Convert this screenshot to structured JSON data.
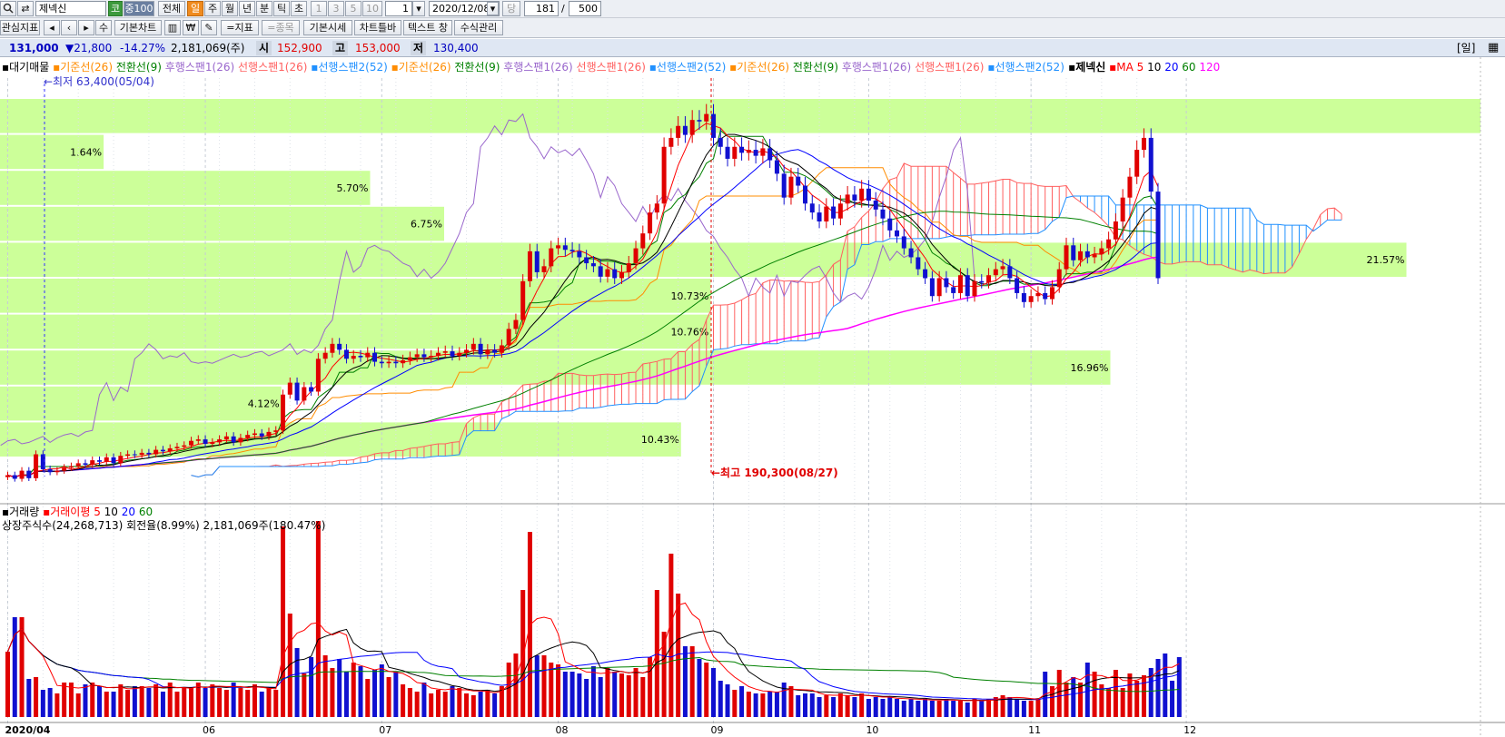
{
  "toolbar": {
    "stock_code": "제넥신",
    "code_badge": "코",
    "index_badge": "중100",
    "period_tabs": [
      "전체",
      "일",
      "주",
      "월",
      "년",
      "분",
      "틱",
      "초"
    ],
    "active_period": "일",
    "intervals": [
      "1",
      "3",
      "5",
      "10"
    ],
    "count_value": "1",
    "date": "2020/12/08",
    "dang": "당",
    "display_count": "181",
    "slash": "/",
    "total_count": "500"
  },
  "toolbar2": {
    "buttons": [
      "관심지표",
      "기본차트",
      "=지표",
      "=종목",
      "기본시세",
      "차트틀바",
      "텍스트 창",
      "수식관리"
    ]
  },
  "infobar": {
    "price": "131,000",
    "change": "▼21,800",
    "change_pct": "-14.27%",
    "volume": "2,181,069(주)",
    "open_label": "시",
    "open": "152,900",
    "high_label": "고",
    "high": "153,000",
    "low_label": "저",
    "low": "130,400",
    "period_badge": "[일]"
  },
  "colors": {
    "up": "#e00000",
    "down": "#1010d0",
    "band": "#ccff99",
    "ma5": "#ff0000",
    "ma10": "#000000",
    "ma20": "#0000ff",
    "ma60": "#008000",
    "ma120": "#ff00ff",
    "lead_span1": "#ff6060",
    "lead_span2": "#2090ff",
    "base_line": "#ff8c00",
    "conv_line": "#008000",
    "lag_span": "#9966cc"
  },
  "legend": [
    {
      "text": "▪대기매물",
      "color": "#000"
    },
    {
      "text": "▪기준선(26)",
      "color": "#ff8c00"
    },
    {
      "text": "전환선(9)",
      "color": "#008000"
    },
    {
      "text": "후행스팬1(26)",
      "color": "#9966cc"
    },
    {
      "text": "선행스팬1(26)",
      "color": "#ff6060"
    },
    {
      "text": "▪선행스팬2(52)",
      "color": "#2090ff"
    },
    {
      "text": "▪기준선(26)",
      "color": "#ff8c00"
    },
    {
      "text": "전환선(9)",
      "color": "#008000"
    },
    {
      "text": "후행스팬1(26)",
      "color": "#9966cc"
    },
    {
      "text": "선행스팬1(26)",
      "color": "#ff6060"
    },
    {
      "text": "▪선행스팬2(52)",
      "color": "#2090ff"
    },
    {
      "text": "▪기준선(26)",
      "color": "#ff8c00"
    },
    {
      "text": "전환선(9)",
      "color": "#008000"
    },
    {
      "text": "후행스팬1(26)",
      "color": "#9966cc"
    },
    {
      "text": "선행스팬1(26)",
      "color": "#ff6060"
    },
    {
      "text": "▪선행스팬2(52)",
      "color": "#2090ff"
    },
    {
      "text": "▪제넥신",
      "color": "#000",
      "bold": true
    },
    {
      "text": "▪MA",
      "color": "#ff0000"
    },
    {
      "text": "5",
      "color": "#ff0000"
    },
    {
      "text": "10",
      "color": "#000"
    },
    {
      "text": "20",
      "color": "#0000ff"
    },
    {
      "text": "60",
      "color": "#008000"
    },
    {
      "text": "120",
      "color": "#ff00ff"
    }
  ],
  "annotations": {
    "low": "←최저 63,400(05/04)",
    "high": "←최고 190,300(08/27)"
  },
  "volume_legend": [
    {
      "text": "▪거래량",
      "color": "#000"
    },
    {
      "text": "▪거래이평",
      "color": "#ff0000"
    },
    {
      "text": "5",
      "color": "#ff0000"
    },
    {
      "text": "10",
      "color": "#000"
    },
    {
      "text": "20",
      "color": "#0000ff"
    },
    {
      "text": "60",
      "color": "#008000"
    }
  ],
  "volume_info": "상장주식수(24,268,713) 회전율(8.99%) 2,181,069주(180.47%)",
  "chart_data": {
    "type": "candlestick",
    "period": "daily",
    "price_range": [
      60000,
      195000
    ],
    "x_labels": [
      "2020/04",
      "06",
      "07",
      "08",
      "09",
      "10",
      "11",
      "12"
    ],
    "supply_bands": [
      {
        "pct": "",
        "fill": 1.0
      },
      {
        "pct": "1.64%",
        "fill": 0.07
      },
      {
        "pct": "5.70%",
        "fill": 0.25
      },
      {
        "pct": "6.75%",
        "fill": 0.3
      },
      {
        "pct": "21.57%",
        "fill": 0.95
      },
      {
        "pct": "10.73%",
        "fill": 0.48
      },
      {
        "pct": "10.76%",
        "fill": 0.48
      },
      {
        "pct": "16.96%",
        "fill": 0.75
      },
      {
        "pct": "4.12%",
        "fill": 0.19
      },
      {
        "pct": "10.43%",
        "fill": 0.46
      },
      {
        "pct": "",
        "fill": 0.0
      }
    ],
    "closes": [
      65000,
      63800,
      66500,
      64000,
      72000,
      67000,
      66000,
      66500,
      67500,
      68000,
      69000,
      68500,
      70000,
      69500,
      71000,
      69000,
      71500,
      72000,
      71800,
      72500,
      72000,
      73500,
      73000,
      74000,
      74500,
      75000,
      76500,
      77000,
      75500,
      76000,
      77000,
      78000,
      76000,
      77500,
      78500,
      79000,
      78000,
      79500,
      80000,
      92000,
      96000,
      90000,
      94500,
      93000,
      104000,
      106000,
      109000,
      107000,
      104000,
      105000,
      104500,
      106000,
      103000,
      102500,
      103000,
      102500,
      103500,
      104500,
      105500,
      104500,
      105000,
      106000,
      106500,
      105000,
      106000,
      107000,
      109000,
      105500,
      107000,
      106000,
      108500,
      114000,
      117000,
      130000,
      140000,
      133000,
      135000,
      141000,
      142000,
      140500,
      140000,
      138000,
      136000,
      135000,
      131500,
      134000,
      131000,
      133000,
      136000,
      141000,
      146000,
      153000,
      156000,
      175000,
      178000,
      182000,
      179000,
      184000,
      183500,
      186000,
      178000,
      175000,
      171000,
      175000,
      173000,
      174000,
      172000,
      174500,
      170500,
      166000,
      158000,
      165000,
      162000,
      156000,
      153000,
      150000,
      155000,
      151000,
      156000,
      159000,
      157000,
      161000,
      157000,
      154000,
      151000,
      147000,
      145000,
      141000,
      138000,
      134000,
      131000,
      125000,
      131000,
      128000,
      126000,
      132000,
      125000,
      130000,
      129500,
      132000,
      134000,
      135000,
      131000,
      126000,
      123000,
      125000,
      126000,
      124000,
      128000,
      134000,
      142000,
      137000,
      140000,
      138000,
      139000,
      141000,
      144000,
      150000,
      158000,
      165000,
      174000,
      178000,
      160000,
      131000
    ],
    "volumes": [
      36,
      55,
      55,
      21,
      22,
      15,
      16,
      13,
      19,
      19,
      13,
      18,
      19,
      17,
      14,
      14,
      18,
      15,
      17,
      17,
      16,
      18,
      14,
      19,
      14,
      16,
      16,
      19,
      16,
      18,
      16,
      15,
      19,
      16,
      15,
      18,
      14,
      16,
      15,
      105,
      57,
      38,
      24,
      33,
      108,
      34,
      27,
      32,
      25,
      30,
      28,
      21,
      26,
      29,
      22,
      25,
      18,
      16,
      14,
      19,
      13,
      15,
      14,
      17,
      16,
      13,
      12,
      14,
      15,
      13,
      17,
      30,
      35,
      70,
      102,
      34,
      34,
      30,
      29,
      25,
      25,
      24,
      21,
      28,
      22,
      27,
      25,
      24,
      23,
      27,
      22,
      33,
      70,
      47,
      90,
      68,
      39,
      39,
      32,
      30,
      27,
      20,
      18,
      15,
      17,
      14,
      13,
      13,
      14,
      14,
      19,
      17,
      12,
      13,
      13,
      11,
      12,
      11,
      13,
      12,
      11,
      13,
      10,
      11,
      10,
      11,
      10,
      9,
      10,
      9,
      10,
      9,
      9,
      10,
      9,
      9,
      8,
      10,
      9,
      10,
      11,
      12,
      11,
      10,
      9,
      9,
      10,
      25,
      17,
      26,
      19,
      22,
      19,
      30,
      25,
      18,
      16,
      26,
      16,
      24,
      20,
      23,
      27,
      32,
      35,
      20,
      33
    ]
  }
}
